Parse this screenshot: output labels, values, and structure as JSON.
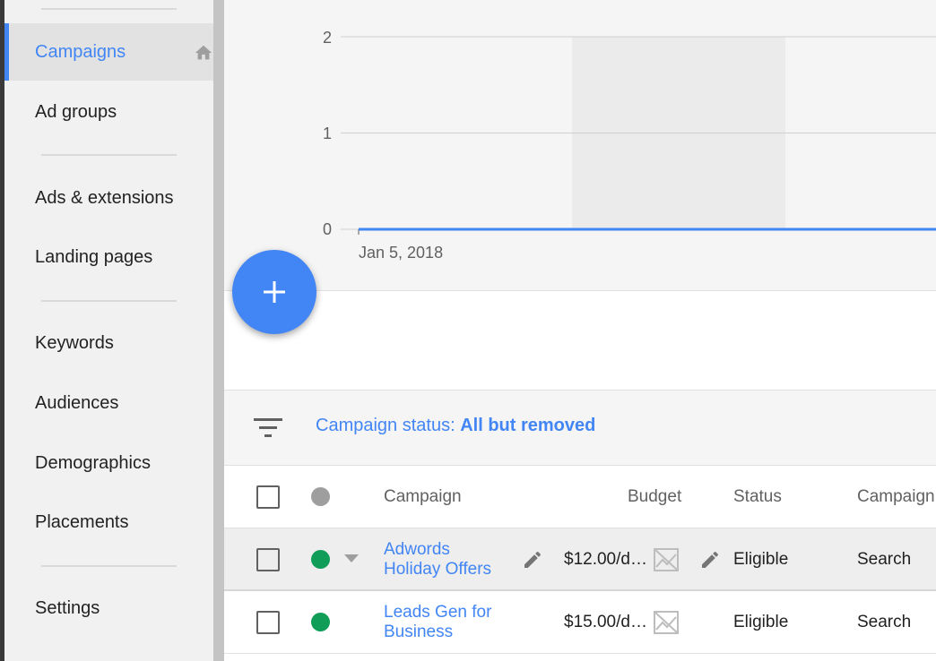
{
  "sidebar": {
    "items": [
      {
        "label": "Campaigns",
        "active": true
      },
      {
        "label": "Ad groups"
      },
      {
        "label": "Ads & extensions"
      },
      {
        "label": "Landing pages"
      },
      {
        "label": "Keywords"
      },
      {
        "label": "Audiences"
      },
      {
        "label": "Demographics"
      },
      {
        "label": "Placements"
      },
      {
        "label": "Settings"
      }
    ]
  },
  "chart": {
    "y_ticks": [
      "2",
      "1",
      "0"
    ],
    "x_label": "Jan 5, 2018"
  },
  "chart_data": {
    "type": "line",
    "x": [
      "Jan 5, 2018"
    ],
    "series": [
      {
        "values": [
          0
        ]
      }
    ],
    "ylim": [
      0,
      2
    ],
    "grid": true
  },
  "filter": {
    "prefix": "Campaign status: ",
    "value": "All but removed"
  },
  "table": {
    "headers": {
      "campaign": "Campaign",
      "budget": "Budget",
      "status": "Status",
      "campaign_type": "Campaign"
    },
    "rows": [
      {
        "campaign": "Adwords Holiday Offers",
        "budget": "$12.00/d…",
        "status": "Eligible",
        "type": "Search"
      },
      {
        "campaign": "Leads Gen for Business",
        "budget": "$15.00/d…",
        "status": "Eligible",
        "type": "Search"
      }
    ]
  },
  "colors": {
    "accent": "#4285f4",
    "status_enabled": "#0f9d58",
    "status_header": "#9e9e9e"
  },
  "icons": [
    "home-icon",
    "add-icon",
    "filter-icon",
    "dropdown-arrow-icon",
    "pencil-icon",
    "chart-off-icon"
  ]
}
